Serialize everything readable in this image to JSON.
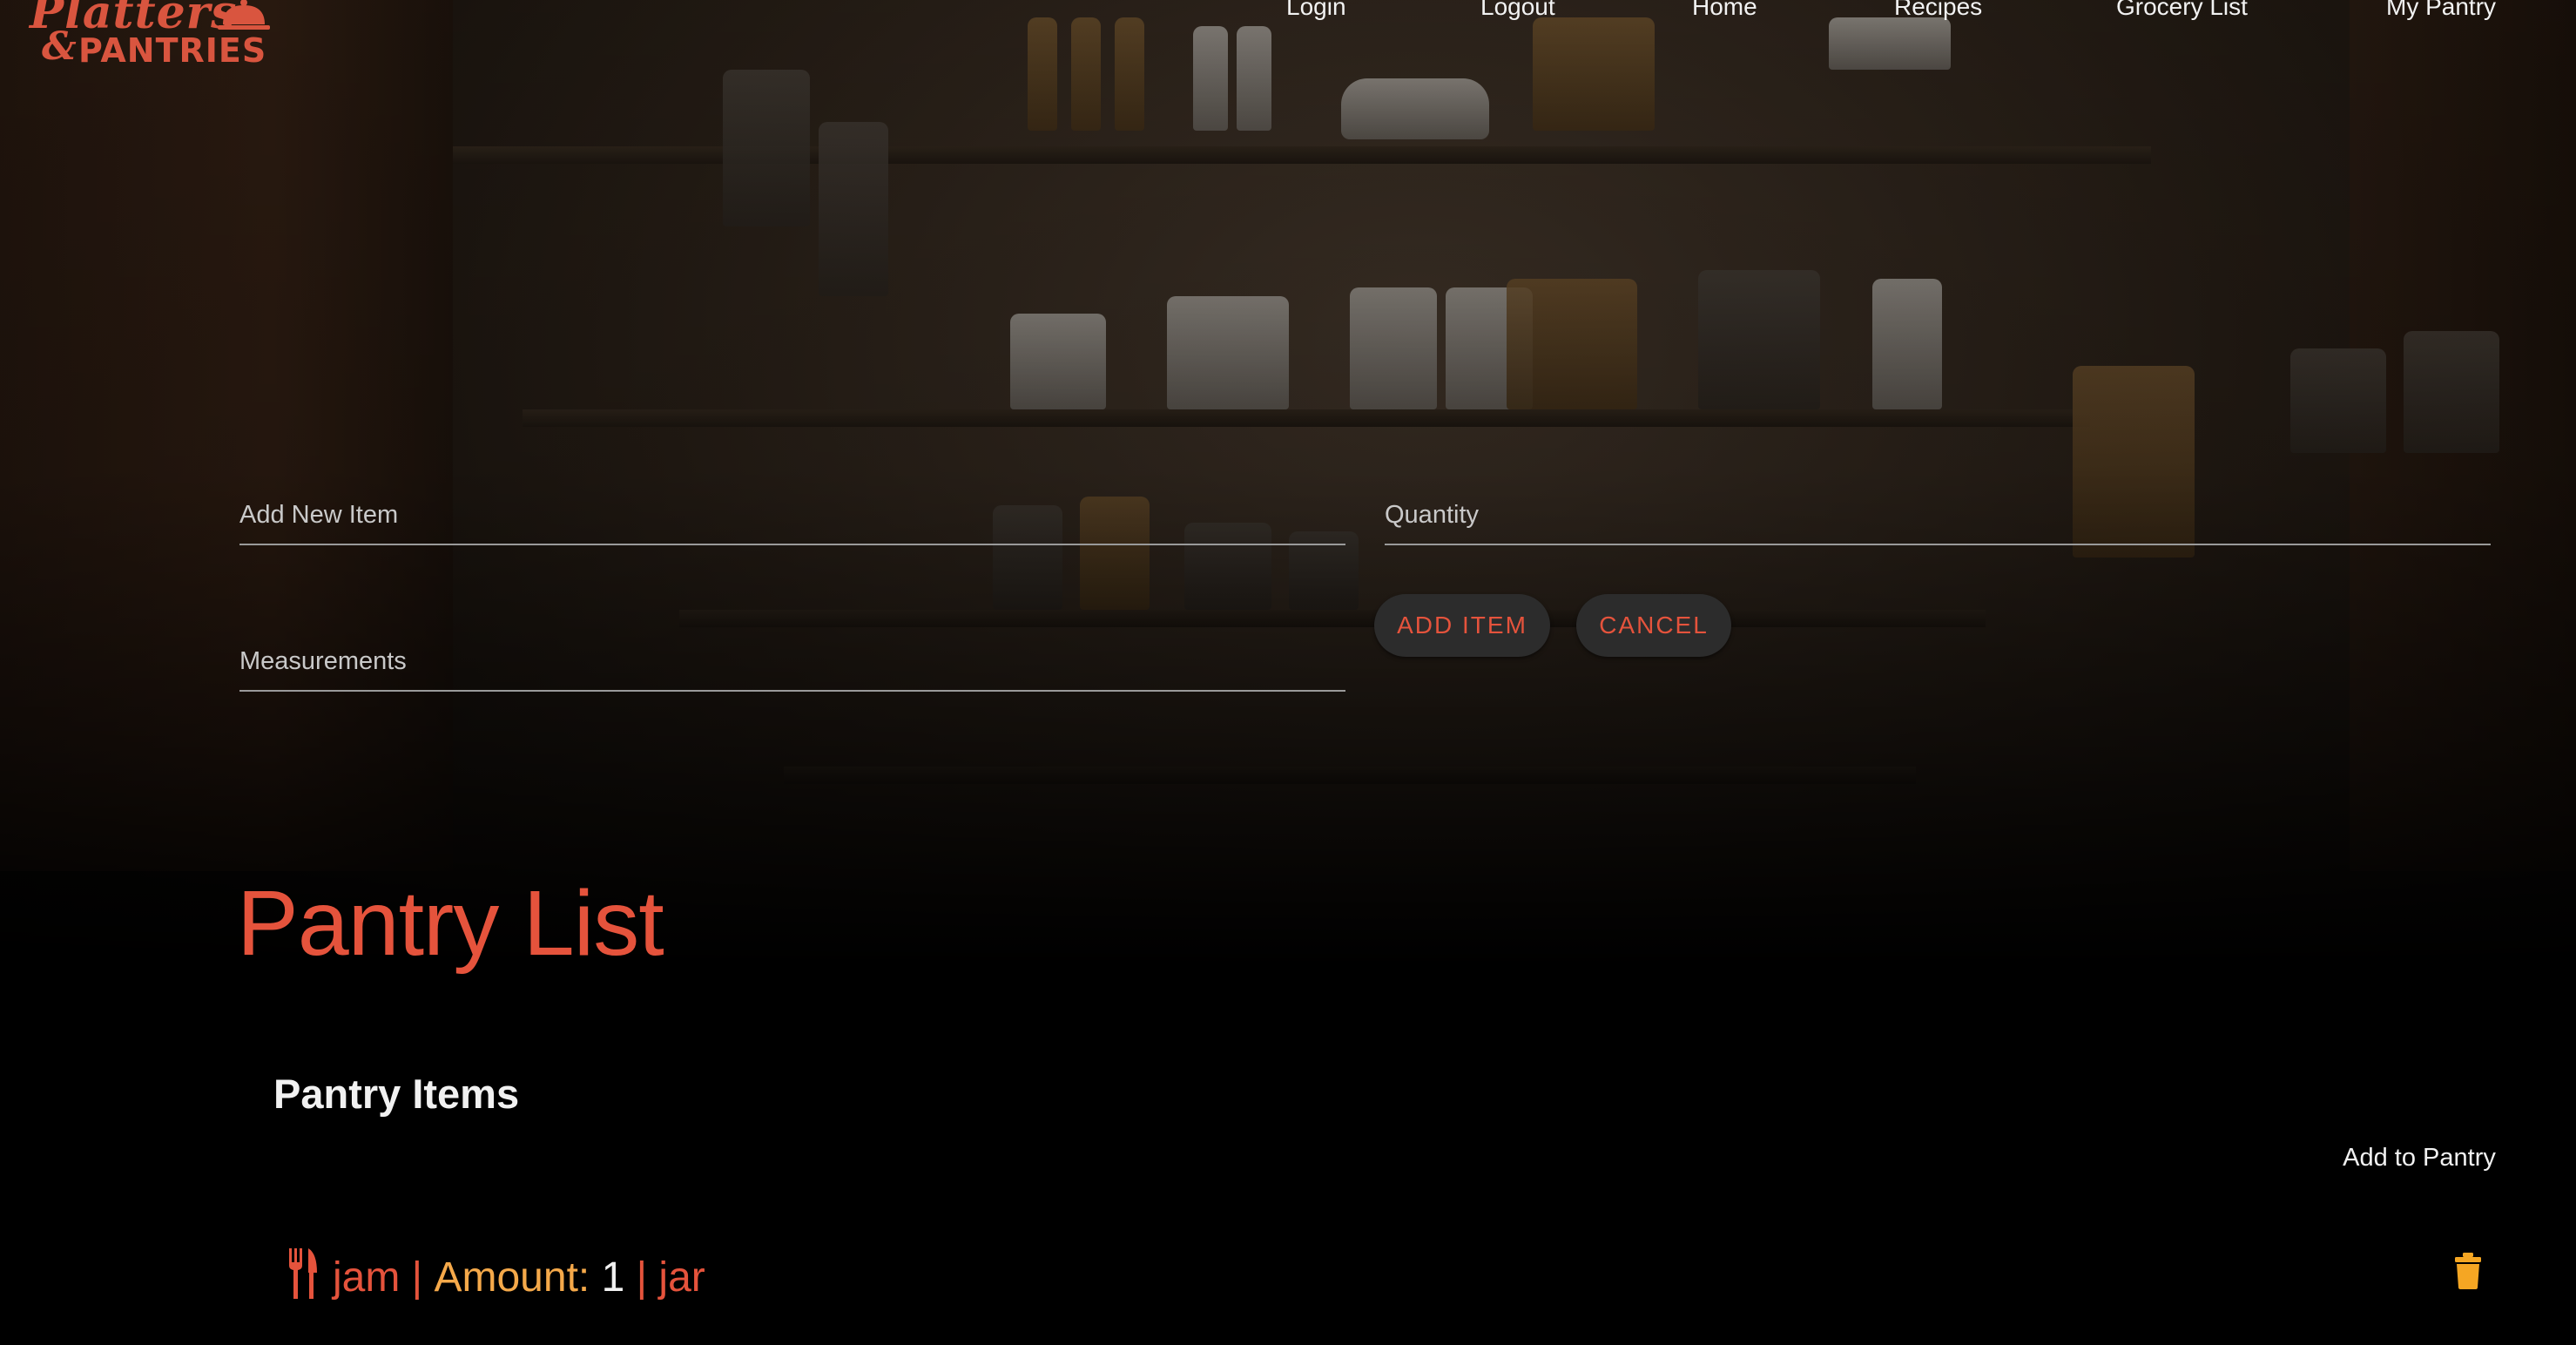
{
  "brand": {
    "logo_script": "Platters",
    "logo_amp": "&",
    "logo_block": "PANTRIES",
    "color": "#d9553f"
  },
  "nav": {
    "items": [
      {
        "label": "Login"
      },
      {
        "label": "Logout"
      },
      {
        "label": "Home"
      },
      {
        "label": "Recipes"
      },
      {
        "label": "Grocery List"
      },
      {
        "label": "My Pantry"
      }
    ]
  },
  "form": {
    "item_placeholder": "Add New Item",
    "item_value": "",
    "quantity_placeholder": "Quantity",
    "quantity_value": "",
    "measurements_placeholder": "Measurements",
    "measurements_value": "",
    "add_label": "Add Item",
    "cancel_label": "Cancel"
  },
  "pantry": {
    "title": "Pantry List",
    "subtitle": "Pantry Items",
    "column_header": "Add to Pantry",
    "items": [
      {
        "icon": "utensils-icon",
        "name": "jam",
        "sep1": " | ",
        "amount_label": "Amount: ",
        "amount": "1",
        "sep2": " | ",
        "unit": "jar",
        "action_icon": "trash-icon"
      }
    ]
  },
  "colors": {
    "accent": "#e5533c",
    "accent_orange": "#f5a94a",
    "trash": "#f5a623",
    "button_bg": "#2c2c2c"
  }
}
